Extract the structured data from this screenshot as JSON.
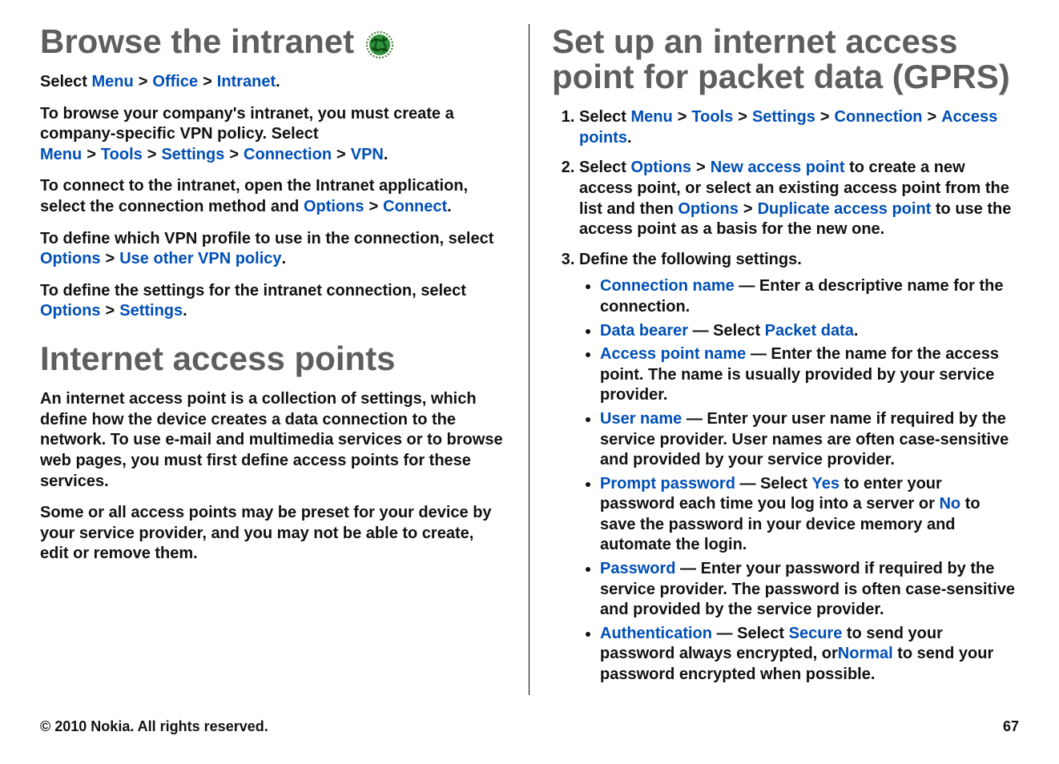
{
  "left": {
    "h1": "Browse the intranet",
    "p1a": "Select ",
    "menu": "Menu",
    "office": "Office",
    "intranet": "Intranet",
    "p1b": ".",
    "p2a": "To browse your company's intranet, you must create a company-specific VPN policy. Select ",
    "tools": "Tools",
    "settings": "Settings",
    "connection": "Connection",
    "vpn": "VPN",
    "p2b": ".",
    "p3a": "To connect to the intranet, open the Intranet application, select the connection method and ",
    "options": "Options",
    "connect": "Connect",
    "p3b": ".",
    "p4a": "To define which VPN profile to use in the connection, select ",
    "useOtherVpn": "Use other VPN policy",
    "p4b": ".",
    "p5a": "To define the settings for the intranet connection, select ",
    "p5b": ".",
    "h1b": "Internet access points",
    "p6": "An internet access point is a collection of settings, which define how the device creates a data connection to the network. To use e-mail and multimedia services or to browse web pages, you must first define access points for these services.",
    "p7": "Some or all access points may be preset for your device by your service provider, and you may not be able to create, edit or remove them."
  },
  "right": {
    "h1": "Set up an internet access point for packet data (GPRS)",
    "step1a": "Select ",
    "menu": "Menu",
    "tools": "Tools",
    "settings": "Settings",
    "connection": "Connection",
    "accessPoints": "Access points",
    "step1b": ".",
    "step2a": "Select ",
    "options": "Options",
    "newAccessPoint": "New access point",
    "step2b": " to create a new access point, or select an existing access point from the list and then ",
    "duplicateAccessPoint": "Duplicate access point",
    "step2c": " to use the access point as a basis for the new one.",
    "step3": "Define the following settings.",
    "bullets": {
      "connName": "Connection name",
      "connNameText": " — Enter a descriptive name for the connection.",
      "dataBearer": "Data bearer",
      "dataBearerMid": " — Select ",
      "packetData": "Packet data",
      "dataBearerEnd": ".",
      "apn": "Access point name",
      "apnText": " — Enter the name for the access point. The name is usually provided by your service provider.",
      "userName": "User name",
      "userNameText": " — Enter your user name if required by the service provider. User names are often case-sensitive and provided by your service provider.",
      "promptPwd": "Prompt password",
      "promptPwdMid1": " — Select ",
      "yes": "Yes",
      "promptPwdMid2": " to enter your password each time you log into a server or ",
      "no": "No",
      "promptPwdEnd": " to save the password in your device memory and automate the login.",
      "password": "Password",
      "passwordText": " — Enter your password if required by the service provider. The password is often case-sensitive and provided by the service provider.",
      "auth": "Authentication",
      "authMid1": " — Select ",
      "secure": "Secure",
      "authMid2": " to send your password always encrypted, or",
      "normal": "Normal",
      "authEnd": " to send your password encrypted when possible."
    }
  },
  "footer": {
    "copyright": "© 2010 Nokia. All rights reserved.",
    "pagenum": "67"
  }
}
